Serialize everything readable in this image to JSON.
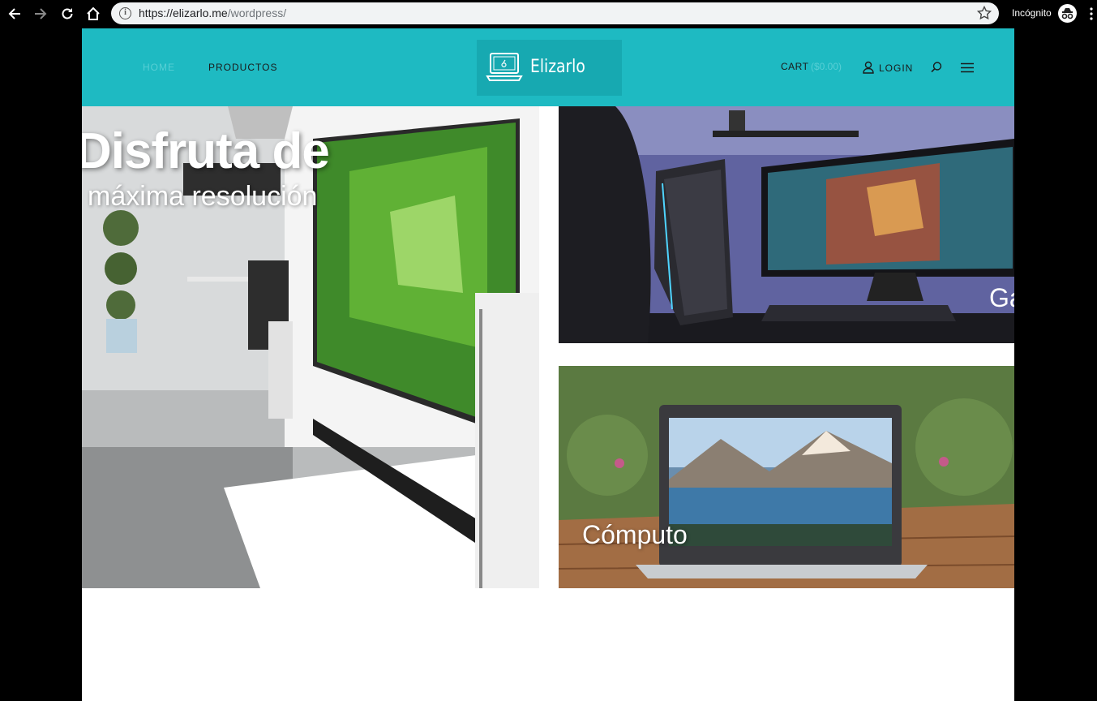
{
  "browser": {
    "url_host": "https://elizarlo.me",
    "url_path": "/wordpress/",
    "incognito_label": "Incógnito"
  },
  "header": {
    "menu": [
      {
        "label": "HOME",
        "active": true
      },
      {
        "label": "PRODUCTOS",
        "active": false
      }
    ],
    "logo_text": "Elizarlo",
    "cart_label": "CART",
    "cart_amount": "($0.00)",
    "login_label": "LOGIN",
    "brand_color": "#1ebac2",
    "logo_bg_color": "#17a9b1"
  },
  "hero": {
    "title": "Disfruta de",
    "subtitle": "máxima resolución",
    "gaming_label": "Ga",
    "computo_label": "Cómputo"
  }
}
